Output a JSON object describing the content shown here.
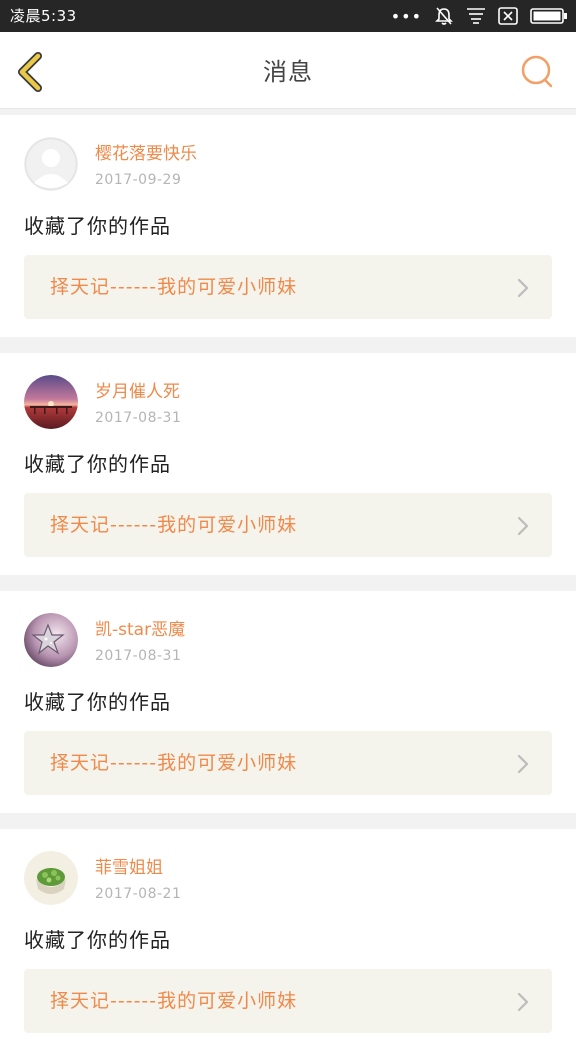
{
  "status_bar": {
    "time": "凌晨5:33",
    "icons": [
      "more-dots-icon",
      "mute-bell-icon",
      "notification-list-icon",
      "sim-blocked-icon",
      "battery-icon"
    ]
  },
  "header": {
    "title": "消息",
    "back_icon": "back-chevron-icon",
    "search_icon": "search-icon"
  },
  "colors": {
    "accent": "#f08a4b",
    "back_icon": "#e9c84a",
    "card_link_bg": "#f4f3ec"
  },
  "messages": [
    {
      "user": "樱花落要快乐",
      "date": "2017-09-29",
      "action": "收藏了你的作品",
      "work": "择天记------我的可爱小师妹",
      "avatar": "default-avatar"
    },
    {
      "user": "岁月催人死",
      "date": "2017-08-31",
      "action": "收藏了你的作品",
      "work": "择天记------我的可爱小师妹",
      "avatar": "sunset-avatar"
    },
    {
      "user": "凯-star恶魔",
      "date": "2017-08-31",
      "action": "收藏了你的作品",
      "work": "择天记------我的可爱小师妹",
      "avatar": "star-avatar"
    },
    {
      "user": "菲雪姐姐",
      "date": "2017-08-21",
      "action": "收藏了你的作品",
      "work": "择天记------我的可爱小师妹",
      "avatar": "plant-avatar"
    }
  ]
}
